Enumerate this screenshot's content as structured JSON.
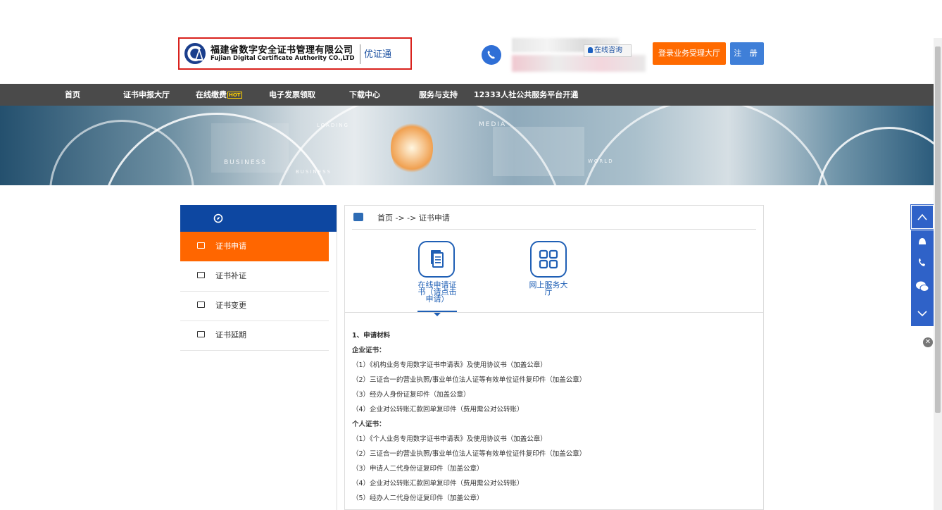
{
  "header": {
    "logo_cn": "福建省数字安全证书管理有限公司",
    "logo_en": "Fujian Digital Certificate Authority CO.,LTD",
    "logo_brand": "优证通",
    "consult_label": "在线咨询",
    "login_hall_label": "登录业务受理大厅",
    "register_label": "注 册"
  },
  "nav": {
    "items": [
      {
        "label": "首页"
      },
      {
        "label": "证书申报大厅"
      },
      {
        "label": "在线缴费",
        "tag": "HOT"
      },
      {
        "label": "电子发票领取"
      },
      {
        "label": "下载中心"
      },
      {
        "label": "服务与支持"
      },
      {
        "label": "12333人社公共服务平台开通"
      }
    ]
  },
  "banner": {
    "words": [
      "BUSINESS",
      "BUSINESS",
      "MEDIA",
      "WORLD",
      "LOADING"
    ]
  },
  "sidebar": {
    "items": [
      {
        "label": "证书申请",
        "active": true
      },
      {
        "label": "证书补证",
        "active": false
      },
      {
        "label": "证书变更",
        "active": false
      },
      {
        "label": "证书延期",
        "active": false
      }
    ]
  },
  "breadcrumb": {
    "text": "首页 -> -> 证书申请"
  },
  "services": [
    {
      "label_lines": [
        "在线申请证",
        "书（请点击",
        "申请）"
      ],
      "icon": "document-icon"
    },
    {
      "label_lines": [
        "网上服务大",
        "厅"
      ],
      "icon": "grid-icon"
    }
  ],
  "content": {
    "heading": "1、申请材料",
    "enterprise_title": "企业证书：",
    "enterprise_items": [
      "（1）《机构业务专用数字证书申请表》及使用协议书（加盖公章）",
      "（2）三证合一的营业执照/事业单位法人证等有效单位证件复印件（加盖公章）",
      "（3）经办人身份证复印件（加盖公章）",
      "（4）企业对公转账汇款回单复印件（费用需公对公转账）"
    ],
    "personal_title": "个人证书：",
    "personal_items": [
      "（1）《个人业务专用数字证书申请表》及使用协议书（加盖公章）",
      "（2）三证合一的营业执照/事业单位法人证等有效单位证件复印件（加盖公章）",
      "（3）申请人二代身份证复印件（加盖公章）",
      "（4）企业对公转账汇款回单复印件（费用需公对公转账）",
      "（5）经办人二代身份证复印件（加盖公章）"
    ]
  },
  "colors": {
    "primary_blue": "#0d47a1",
    "active_orange": "#ff6600",
    "nav_bg": "#4a4a4a",
    "float_blue": "#2f62c8"
  }
}
